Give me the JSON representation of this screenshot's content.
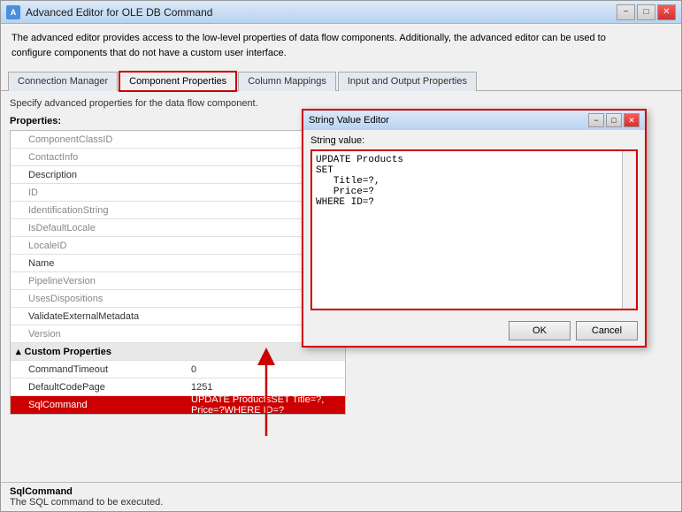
{
  "window": {
    "title": "Advanced Editor for OLE DB Command",
    "icon": "A",
    "controls": {
      "minimize": "−",
      "maximize": "□",
      "close": "✕"
    }
  },
  "description": {
    "line1": "The advanced editor provides access to the low-level properties of data flow components. Additionally, the advanced editor can be used to",
    "line2": "configure components that do not have a custom user interface."
  },
  "tabs": [
    {
      "id": "connection-manager",
      "label": "Connection Manager",
      "active": false,
      "highlighted": false
    },
    {
      "id": "component-properties",
      "label": "Component Properties",
      "active": true,
      "highlighted": true
    },
    {
      "id": "column-mappings",
      "label": "Column Mappings",
      "active": false,
      "highlighted": false
    },
    {
      "id": "input-output-properties",
      "label": "Input and Output Properties",
      "active": false,
      "highlighted": false
    }
  ],
  "subtitle": "Specify advanced properties for the data flow component.",
  "properties_label": "Properties:",
  "properties": [
    {
      "name": "ComponentClassID",
      "value": "",
      "type": "normal",
      "indent": true
    },
    {
      "name": "ContactInfo",
      "value": "",
      "type": "normal",
      "indent": true
    },
    {
      "name": "Description",
      "value": "",
      "type": "normal",
      "indent": true
    },
    {
      "name": "ID",
      "value": "",
      "type": "normal",
      "indent": true
    },
    {
      "name": "IdentificationString",
      "value": "",
      "type": "normal",
      "indent": true
    },
    {
      "name": "IsDefaultLocale",
      "value": "",
      "type": "normal",
      "indent": true
    },
    {
      "name": "LocaleID",
      "value": "",
      "type": "normal",
      "indent": true
    },
    {
      "name": "Name",
      "value": "",
      "type": "normal",
      "indent": true
    },
    {
      "name": "PipelineVersion",
      "value": "",
      "type": "normal",
      "indent": true
    },
    {
      "name": "UsesDispositions",
      "value": "",
      "type": "normal",
      "indent": true
    },
    {
      "name": "ValidateExternalMetadata",
      "value": "",
      "type": "normal",
      "indent": true
    },
    {
      "name": "Version",
      "value": "",
      "type": "normal",
      "indent": true
    },
    {
      "name": "Custom Properties",
      "value": "",
      "type": "section"
    },
    {
      "name": "CommandTimeout",
      "value": "0",
      "type": "normal",
      "indent": true
    },
    {
      "name": "DefaultCodePage",
      "value": "1251",
      "type": "normal",
      "indent": true
    },
    {
      "name": "SqlCommand",
      "value": "UPDATE ProductsSET  Title=?,  Price=?WHERE ID=?",
      "type": "selected",
      "indent": true
    }
  ],
  "dialog": {
    "title": "String Value Editor",
    "controls": {
      "minimize": "−",
      "maximize": "□",
      "close": "✕"
    },
    "string_value_label": "String value:",
    "textarea_content": "UPDATE Products\nSET\n   Title=?,\n   Price=?\nWHERE ID=?",
    "ok_label": "OK",
    "cancel_label": "Cancel"
  },
  "status": {
    "title": "SqlCommand",
    "description": "The SQL command to be executed."
  }
}
